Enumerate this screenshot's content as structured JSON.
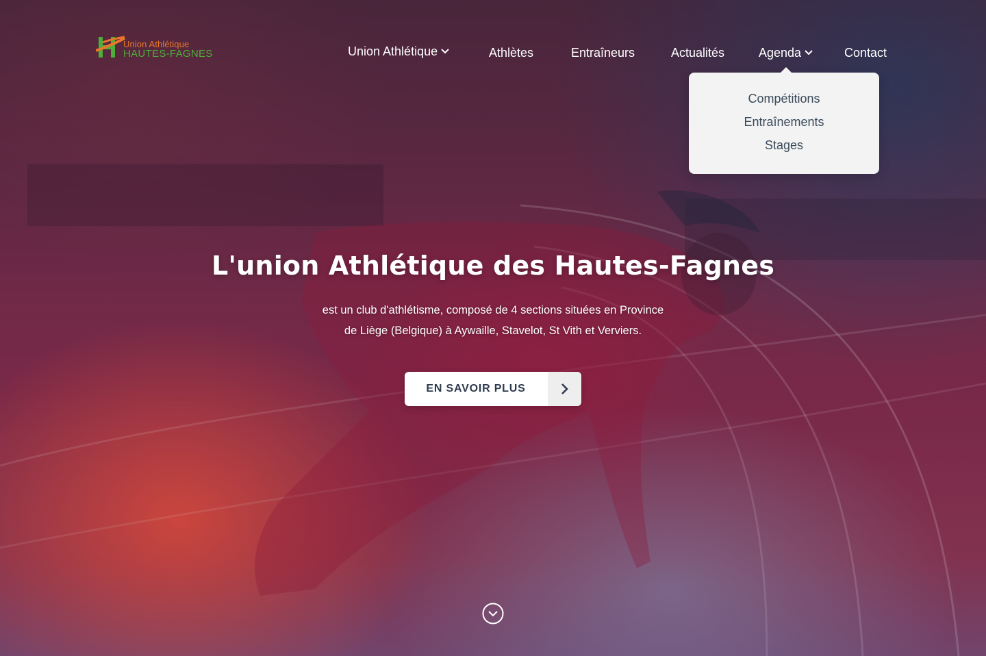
{
  "brand": {
    "line1": "Union Athlétique",
    "line2": "HAUTES-FAGNES",
    "colors": {
      "orange": "#e8762c",
      "green": "#4caf3a"
    }
  },
  "nav": {
    "items": [
      {
        "label": "Union Athlétique",
        "has_dropdown": true
      },
      {
        "label": "Athlètes",
        "has_dropdown": false
      },
      {
        "label": "Entraîneurs",
        "has_dropdown": false
      },
      {
        "label": "Actualités",
        "has_dropdown": false
      },
      {
        "label": "Agenda",
        "has_dropdown": true,
        "open": true
      },
      {
        "label": "Contact",
        "has_dropdown": false
      }
    ]
  },
  "agenda_dropdown": {
    "items": [
      "Compétitions",
      "Entraînements",
      "Stages"
    ]
  },
  "hero": {
    "title": "L'union Athlétique des Hautes-Fagnes",
    "subtitle_line1": "est un club d'athlétisme, composé de 4 sections situées en Province",
    "subtitle_line2": "de Liège (Belgique) à Aywaille, Stavelot, St Vith et Verviers.",
    "cta_label": "EN SAVOIR PLUS",
    "cta_icon": "chevron-right-icon",
    "scroll_icon": "chevron-down-circle-icon"
  },
  "colors": {
    "cta_text": "#2d3a4e",
    "dropdown_bg": "#f3f3f3",
    "dropdown_text": "#3a4a5a"
  }
}
